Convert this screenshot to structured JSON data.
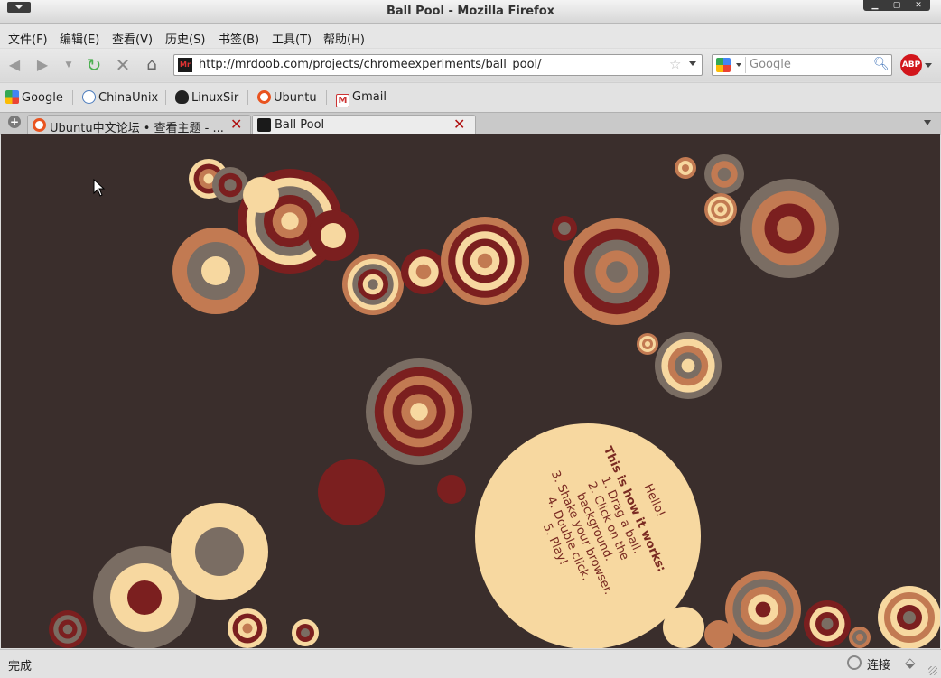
{
  "window": {
    "title": "Ball Pool - Mozilla Firefox"
  },
  "menubar": {
    "items": [
      "文件(F)",
      "编辑(E)",
      "查看(V)",
      "历史(S)",
      "书签(B)",
      "工具(T)",
      "帮助(H)"
    ]
  },
  "navbar": {
    "url": "http://mrdoob.com/projects/chromeexperiments/ball_pool/",
    "site_icon_text": "Mr",
    "search_placeholder": "Google",
    "abp_label": "ABP"
  },
  "bookmarks": [
    "Google",
    "ChinaUnix",
    "LinuxSir",
    "Ubuntu",
    "Gmail"
  ],
  "tabs": [
    {
      "label": "Ubuntu中文论坛 • 查看主题 - ...",
      "active": false
    },
    {
      "label": "Ball Pool",
      "active": true
    }
  ],
  "content": {
    "hello": "Hello!",
    "how_title": "This is how it works:",
    "steps": [
      "1. Drag a ball.",
      "2. Click on the background.",
      "3. Shake your browser.",
      "4. Double click.",
      "5. Play!"
    ]
  },
  "statusbar": {
    "status": "完成",
    "connection": "连接"
  },
  "colors": {
    "background": "#3a2e2c",
    "palette": [
      "#f7d8a0",
      "#c27a52",
      "#7b1f1f",
      "#7a6d63"
    ]
  }
}
